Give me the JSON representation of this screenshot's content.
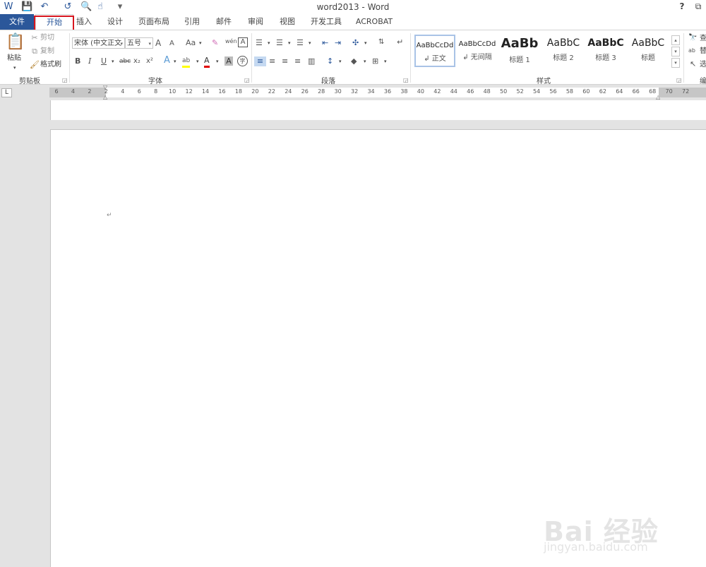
{
  "window": {
    "title": "word2013 - Word",
    "help": "?",
    "restore": "⧉"
  },
  "qat": {
    "word_icon": "W",
    "save_icon": "💾",
    "undo_icon": "↶",
    "redo_icon": "↺",
    "preview_icon": "🔍",
    "touch_icon": "☝",
    "customize_icon": "▾"
  },
  "tabs": [
    {
      "label": "文件"
    },
    {
      "label": "开始"
    },
    {
      "label": "插入"
    },
    {
      "label": "设计"
    },
    {
      "label": "页面布局"
    },
    {
      "label": "引用"
    },
    {
      "label": "邮件"
    },
    {
      "label": "审阅"
    },
    {
      "label": "视图"
    },
    {
      "label": "开发工具"
    },
    {
      "label": "ACROBAT"
    }
  ],
  "clipboard": {
    "paste": "粘贴",
    "cut": "剪切",
    "copy": "复制",
    "format_painter": "格式刷",
    "label": "剪贴板"
  },
  "font": {
    "name": "宋体 (中文正文",
    "size": "五号",
    "label": "字体",
    "bold": "B",
    "italic": "I",
    "underline": "U",
    "strike": "abc",
    "subscript": "x₂",
    "superscript": "x²",
    "grow": "A",
    "shrink": "A",
    "case": "Aa",
    "effects": "A",
    "highlight": "ab",
    "color": "A",
    "shade": "A",
    "enclose": "字",
    "phonetic": "wén",
    "border": "A",
    "clear": "✎"
  },
  "paragraph": {
    "label": "段落"
  },
  "styles": {
    "label": "样式",
    "items": [
      {
        "sample": "AaBbCcDd",
        "name": "↲ 正文"
      },
      {
        "sample": "AaBbCcDd",
        "name": "↲ 无间隔"
      },
      {
        "sample": "AaBb",
        "name": "标题 1"
      },
      {
        "sample": "AaBbC",
        "name": "标题 2"
      },
      {
        "sample": "AaBbC",
        "name": "标题 3"
      },
      {
        "sample": "AaBbC",
        "name": "标题"
      }
    ]
  },
  "editing": {
    "find": "查",
    "replace": "替",
    "select": "选",
    "label": "编"
  },
  "ruler": {
    "ticks": [
      "6",
      "4",
      "2",
      "2",
      "4",
      "6",
      "8",
      "10",
      "12",
      "14",
      "16",
      "18",
      "20",
      "22",
      "24",
      "26",
      "28",
      "30",
      "32",
      "34",
      "36",
      "38",
      "40",
      "42",
      "44",
      "46",
      "48",
      "50",
      "52",
      "54",
      "56",
      "58",
      "60",
      "62",
      "64",
      "66",
      "68",
      "70",
      "72"
    ],
    "corner": "L"
  },
  "document": {
    "paragraph_mark": "↵"
  },
  "watermark": {
    "logo": "Bai 经验",
    "url": "jingyan.baidu.com"
  }
}
